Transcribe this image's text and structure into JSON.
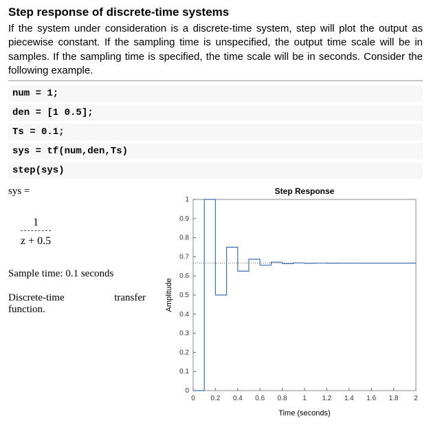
{
  "title": "Step response of discrete-time systems",
  "paragraph": "If the system under consideration is a discrete-time system, step will plot the output as piecewise constant. If the sampling time is unspecified, the output time scale will be in samples. If the sampling time is specified, the time scale will be in seconds. Consider the following example.",
  "code": {
    "l1": "num = 1;",
    "l2": "den = [1 0.5];",
    "l3": "Ts = 0.1;",
    "l4": "sys = tf(num,den,Ts)",
    "l5": "step(sys)"
  },
  "output": {
    "syseq": "sys =",
    "numerator": "1",
    "denominator": "z + 0.5",
    "sample_time": "Sample time: 0.1 seconds",
    "desc1": "Discrete-time",
    "desc2": "transfer",
    "desc3": "function."
  },
  "chart_data": {
    "type": "line",
    "title": "Step Response",
    "xlabel": "Time (seconds)",
    "ylabel": "Amplitude",
    "xlim": [
      0,
      2
    ],
    "ylim": [
      0,
      1
    ],
    "xticks": [
      0,
      0.2,
      0.4,
      0.6,
      0.8,
      1,
      1.2,
      1.4,
      1.6,
      1.8,
      2
    ],
    "yticks": [
      0,
      0.1,
      0.2,
      0.3,
      0.4,
      0.5,
      0.6,
      0.7,
      0.8,
      0.9,
      1
    ],
    "final_value_line": 0.667,
    "x": [
      0,
      0.1,
      0.2,
      0.3,
      0.4,
      0.5,
      0.6,
      0.7,
      0.8,
      0.9,
      1.0,
      1.1,
      1.2,
      1.3,
      1.4,
      1.5,
      1.6,
      1.7,
      1.8,
      1.9,
      2.0
    ],
    "y": [
      0,
      1.0,
      0.5,
      0.75,
      0.625,
      0.6875,
      0.6563,
      0.6719,
      0.6641,
      0.668,
      0.666,
      0.667,
      0.6665,
      0.6668,
      0.6666,
      0.6667,
      0.6667,
      0.6667,
      0.6667,
      0.6667,
      0.6667
    ]
  }
}
